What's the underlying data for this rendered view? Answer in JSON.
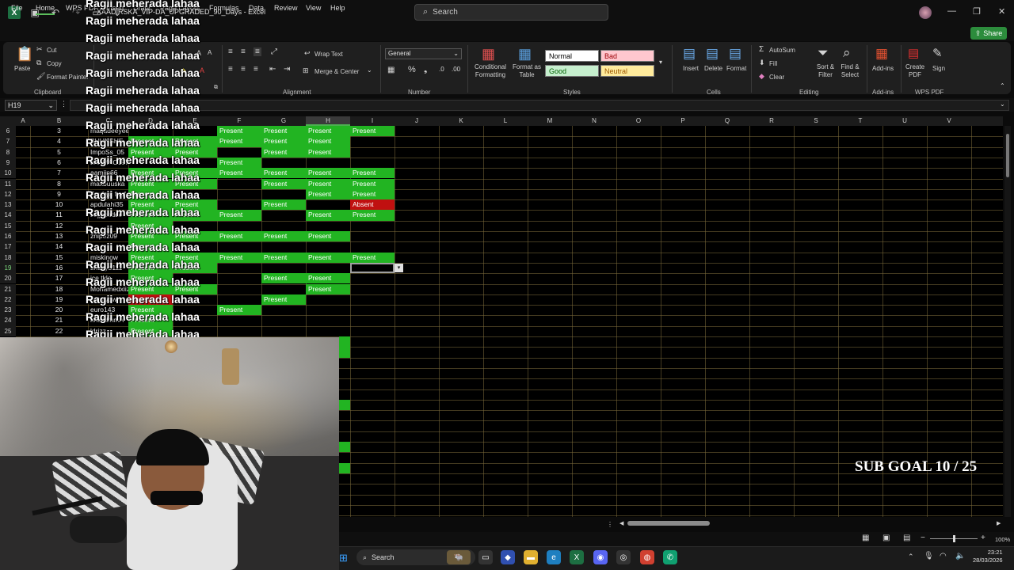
{
  "app": {
    "title": "XAADIRSKA_VIP-DA_UPGRADED_90_Days - Excel",
    "search_placeholder": "Search",
    "share_label": "Share"
  },
  "menu": [
    "File",
    "Home",
    "WPS PDF",
    "Insert",
    "Draw",
    "Page Layout",
    "Formulas",
    "Data",
    "Review",
    "View",
    "Help"
  ],
  "ribbon": {
    "clipboard": {
      "paste": "Paste",
      "cut": "Cut",
      "copy": "Copy",
      "format_painter": "Format Painter",
      "group": "Clipboard"
    },
    "alignment": {
      "wrap_text": "Wrap Text",
      "merge_center": "Merge & Center",
      "group": "Alignment"
    },
    "number": {
      "format": "General",
      "group": "Number"
    },
    "styles": {
      "conditional_formatting": "Conditional Formatting",
      "format_as_table": "Format as Table",
      "normal": "Normal",
      "bad": "Bad",
      "good": "Good",
      "neutral": "Neutral",
      "group": "Styles"
    },
    "cells": {
      "insert": "Insert",
      "delete": "Delete",
      "format": "Format",
      "group": "Cells"
    },
    "editing": {
      "autosum": "AutoSum",
      "fill": "Fill",
      "clear": "Clear",
      "sort_filter": "Sort & Filter",
      "find_select": "Find & Select",
      "group": "Editing"
    },
    "addins": {
      "addins": "Add-ins",
      "group": "Add-ins"
    },
    "wps": {
      "create_pdf": "Create PDF",
      "sign": "Sign",
      "group": "WPS PDF"
    }
  },
  "formula_bar": {
    "name_box": "H19"
  },
  "columns": [
    "A",
    "B",
    "C",
    "D",
    "E",
    "F",
    "G",
    "H",
    "I",
    "J",
    "K",
    "L",
    "M",
    "N",
    "O",
    "P",
    "Q",
    "R",
    "S",
    "T",
    "U",
    "V"
  ],
  "rows": [
    {
      "r": "6",
      "a": "3",
      "b": "maqadeeyee",
      "c": "",
      "d": "",
      "e": "Present",
      "f": "Present",
      "g": "Present",
      "h": "Present"
    },
    {
      "r": "7",
      "a": "4",
      "b": "BUUNSHE",
      "c": "Present",
      "d": "Present",
      "e": "Present",
      "f": "Present",
      "g": "Present",
      "h": ""
    },
    {
      "r": "8",
      "a": "5",
      "b": "ImpoSs_05",
      "c": "Present",
      "d": "Present",
      "e": "",
      "f": "Present",
      "g": "Present",
      "h": ""
    },
    {
      "r": "9",
      "a": "6",
      "b": "JAAMAC197",
      "c": "",
      "d": "",
      "e": "Present",
      "f": "",
      "g": "",
      "h": ""
    },
    {
      "r": "10",
      "a": "7",
      "b": "aamiin66",
      "c": "Present",
      "d": "Present",
      "e": "Present",
      "f": "Present",
      "g": "Present",
      "h": "Present"
    },
    {
      "r": "11",
      "a": "8",
      "b": "maxbuuska",
      "c": "Present",
      "d": "Present",
      "e": "",
      "f": "Present",
      "g": "Present",
      "h": "Present"
    },
    {
      "r": "12",
      "a": "9",
      "b": "Fuuf ya fuuf",
      "c": "Present",
      "d": "",
      "e": "",
      "f": "",
      "g": "Present",
      "h": "Present"
    },
    {
      "r": "13",
      "a": "10",
      "b": "apdulahi35",
      "c": "Present",
      "d": "Present",
      "e": "",
      "f": "Present",
      "g": "",
      "h": "Absent"
    },
    {
      "r": "14",
      "a": "11",
      "b": "sojjacadde",
      "c": "Present",
      "d": "Present",
      "e": "Present",
      "f": "",
      "g": "Present",
      "h": "Present"
    },
    {
      "r": "15",
      "a": "12",
      "b": "",
      "c": "Present",
      "d": "",
      "e": "",
      "f": "",
      "g": "",
      "h": ""
    },
    {
      "r": "16",
      "a": "13",
      "b": "znipez09",
      "c": "Present",
      "d": "Present",
      "e": "Present",
      "f": "Present",
      "g": "Present",
      "h": ""
    },
    {
      "r": "17",
      "a": "14",
      "b": "",
      "c": "Present",
      "d": "",
      "e": "",
      "f": "",
      "g": "",
      "h": ""
    },
    {
      "r": "18",
      "a": "15",
      "b": "miskinow",
      "c": "Present",
      "d": "Present",
      "e": "Present",
      "f": "Present",
      "g": "Present",
      "h": "Present"
    },
    {
      "r": "19",
      "a": "16",
      "b": "shuayb111",
      "c": "Present",
      "d": "Present",
      "e": "",
      "f": "",
      "g": "",
      "h": ""
    },
    {
      "r": "20",
      "a": "17",
      "b": "ice tkle",
      "c": "Present",
      "d": "",
      "e": "",
      "f": "Present",
      "g": "Present",
      "h": ""
    },
    {
      "r": "21",
      "a": "18",
      "b": "Mohamedxiiz",
      "c": "Present",
      "d": "Present",
      "e": "",
      "f": "",
      "g": "Present",
      "h": ""
    },
    {
      "r": "22",
      "a": "19",
      "b": "botoiyow",
      "c": "Absent",
      "d": "",
      "e": "",
      "f": "Present",
      "g": "",
      "h": ""
    },
    {
      "r": "23",
      "a": "20",
      "b": "euro143",
      "c": "Present",
      "d": "",
      "e": "Present",
      "f": "",
      "g": "",
      "h": ""
    },
    {
      "r": "24",
      "a": "21",
      "b": "khalidmmA",
      "c": "Present",
      "d": "",
      "e": "",
      "f": "",
      "g": "",
      "h": ""
    },
    {
      "r": "25",
      "a": "22",
      "b": "ldrizz",
      "c": "Present",
      "d": "",
      "e": "",
      "f": "",
      "g": "",
      "h": ""
    }
  ],
  "overlay": {
    "repeated_text": "Ragii meherada lahaa",
    "sub_goal": "SUB GOAL 10 / 25"
  },
  "status": {
    "zoom": "100%"
  },
  "taskbar": {
    "search": "Search",
    "time": "23:21",
    "date": "28/03/2026"
  },
  "colors": {
    "present": "#22b422",
    "absent": "#c01010",
    "accent": "#2c8c3c"
  }
}
